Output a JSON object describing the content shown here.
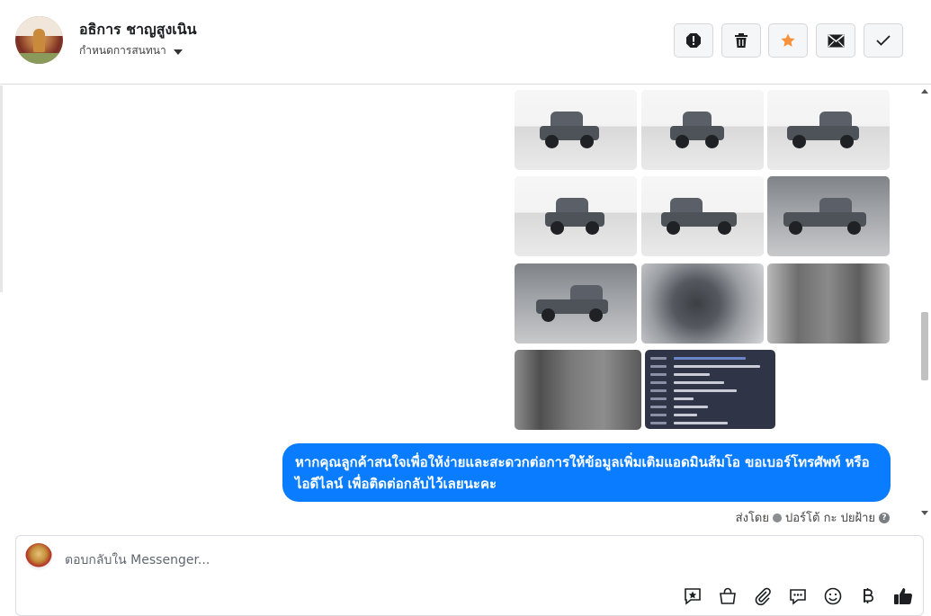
{
  "header": {
    "contact_name": "อธิการ ชาญสูงเนิน",
    "assign_label": "กำหนดการสนทนา",
    "actions": [
      {
        "icon": "alert-icon",
        "name": "mark-spam-button"
      },
      {
        "icon": "trash-icon",
        "name": "delete-button"
      },
      {
        "icon": "star-icon",
        "name": "star-button",
        "color": "#f7923b"
      },
      {
        "icon": "mail-icon",
        "name": "mark-unread-button"
      },
      {
        "icon": "check-icon",
        "name": "mark-done-button"
      }
    ]
  },
  "chat": {
    "images": [
      {
        "label": "truck-front-left"
      },
      {
        "label": "truck-front"
      },
      {
        "label": "truck-rear-right"
      },
      {
        "label": "truck-rear"
      },
      {
        "label": "truck-rear-left"
      },
      {
        "label": "truck-side"
      },
      {
        "label": "truck-side-far"
      },
      {
        "label": "interior-dashboard"
      },
      {
        "label": "interior-seats"
      },
      {
        "label": "interior-rear-seats"
      },
      {
        "label": "spec-sheet"
      }
    ],
    "message_text": "หากคุณลูกค้าสนใจเพื่อให้ง่ายและสะดวกต่อการให้ข้อมูลเพิ่มเติมแอดมินส้มโอ ขอเบอร์โทรศัพท์ หรือ ไอดีไลน์ เพื่อติดต่อกลับไว้เลยนะคะ",
    "sent_by_label": "ส่งโดย",
    "sent_by_name": "ปอร์โต้ กะ ปยฝ้าย",
    "bubble_color": "#0a7cff"
  },
  "composer": {
    "placeholder": "ตอบกลับใน Messenger...",
    "tools": [
      "saved-reply-icon",
      "shop-icon",
      "attachment-icon",
      "quick-reply-icon",
      "emoji-icon",
      "baht-icon",
      "thumbs-up-icon"
    ]
  }
}
